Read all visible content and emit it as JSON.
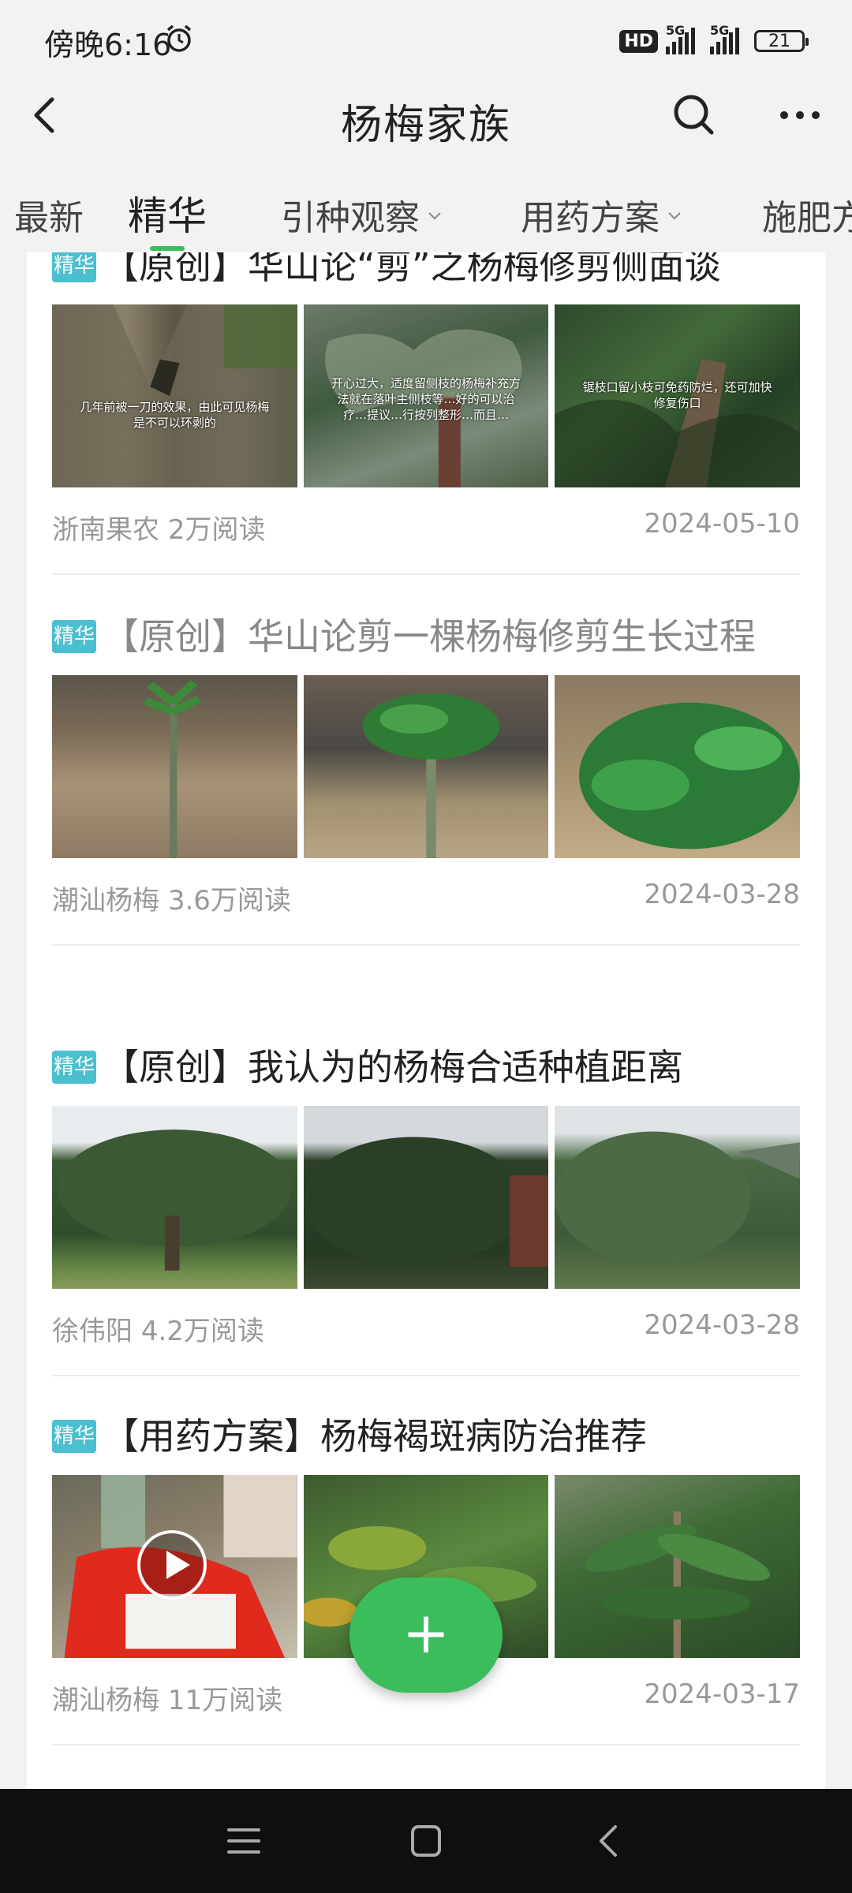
{
  "status_bar": {
    "time": "傍晚6:16",
    "hd_badge": "HD",
    "network_1": "5G",
    "network_2": "5G",
    "battery": "21"
  },
  "header": {
    "title": "杨梅家族"
  },
  "tabs": [
    {
      "label": "最新",
      "active": false,
      "has_dropdown": false
    },
    {
      "label": "精华",
      "active": true,
      "has_dropdown": false
    },
    {
      "label": "引种观察",
      "active": false,
      "has_dropdown": true
    },
    {
      "label": "用药方案",
      "active": false,
      "has_dropdown": true
    },
    {
      "label": "施肥方",
      "active": false,
      "has_dropdown": false
    }
  ],
  "badge_text": "精华",
  "articles": [
    {
      "title": "【原创】华山论“剪”之杨梅修剪侧面谈",
      "author": "浙南果农",
      "reads": "2万阅读",
      "date": "2024-05-10",
      "image_captions": [
        "几年前被一刀的效果，由此可见杨梅是不可以环剥的",
        "开心过大，适度留侧枝的杨梅补充方法就在落叶主侧枝等…好的可以治疗…提议…行按列整形…而且…",
        "锯枝口留小枝可免药防烂，还可加快修复伤口"
      ]
    },
    {
      "title": "【原创】华山论剪一棵杨梅修剪生长过程",
      "author": "潮汕杨梅",
      "reads": "3.6万阅读",
      "date": "2024-03-28"
    },
    {
      "title": "【原创】我认为的杨梅合适种植距离",
      "author": "徐伟阳",
      "reads": "4.2万阅读",
      "date": "2024-03-28"
    },
    {
      "title": "【用药方案】杨梅褐斑病防治推荐",
      "author": "潮汕杨梅",
      "reads": "11万阅读",
      "date": "2024-03-17"
    }
  ],
  "fab": {
    "label": "+"
  },
  "colors": {
    "accent": "#3bbd5c",
    "badge": "#4bbfcf",
    "background": "#f2f2f2",
    "nav_bar": "#0f0f0f"
  }
}
